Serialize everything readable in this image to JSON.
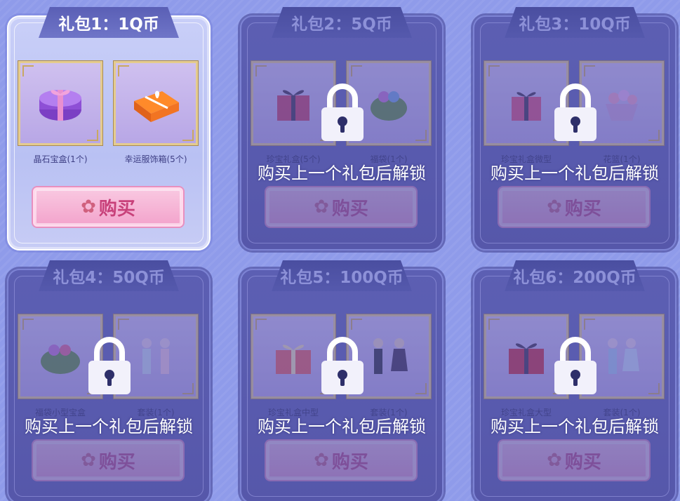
{
  "buy_label": "购买",
  "lock_message": "购买上一个礼包后解锁",
  "packs": [
    {
      "title": "礼包1：1Q币",
      "locked": false,
      "items": [
        {
          "name": "晶石宝盒(1个)"
        },
        {
          "name": "幸运服饰箱(5个)"
        }
      ]
    },
    {
      "title": "礼包2：5Q币",
      "locked": true,
      "items": [
        {
          "name": "珍宝礼盒(5个)"
        },
        {
          "name": "福袋(1个)"
        }
      ]
    },
    {
      "title": "礼包3：10Q币",
      "locked": true,
      "items": [
        {
          "name": "珍宝礼盒微型"
        },
        {
          "name": "花篮(1个)"
        }
      ]
    },
    {
      "title": "礼包4：50Q币",
      "locked": true,
      "items": [
        {
          "name": "福袋小型宝盒"
        },
        {
          "name": "套装(1个)"
        }
      ]
    },
    {
      "title": "礼包5：100Q币",
      "locked": true,
      "items": [
        {
          "name": "珍宝礼盒中型"
        },
        {
          "name": "套装(1个)"
        }
      ]
    },
    {
      "title": "礼包6：200Q币",
      "locked": true,
      "items": [
        {
          "name": "珍宝礼盒大型"
        },
        {
          "name": "套装(1个)"
        }
      ]
    }
  ],
  "colors": {
    "accent_pink": "#f3a4cc",
    "locked_panel": "#5657aa",
    "background": "#8f9bea"
  }
}
